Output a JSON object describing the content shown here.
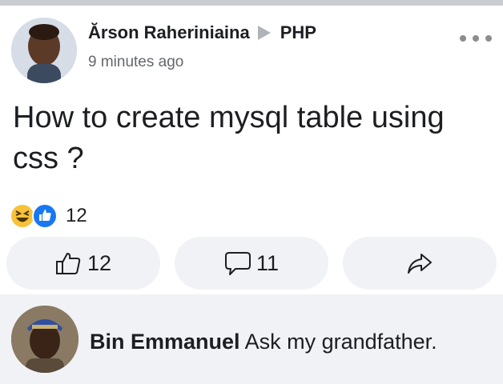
{
  "post": {
    "author": "Ărson Raheriniaina",
    "group": "PHP",
    "time": "9 minutes ago",
    "text": "How to create mysql table using css ?",
    "reaction_count": "12",
    "reaction_icons": [
      "haha-emoji",
      "like-thumb"
    ]
  },
  "actions": {
    "like_count": "12",
    "comment_count": "11",
    "share_icon": "share-arrow-icon"
  },
  "comment": {
    "author": "Bin Emmanuel",
    "text": "Ask my grandfather."
  },
  "colors": {
    "like_blue": "#1877f2",
    "haha_yellow": "#f7c23a",
    "button_bg": "#f0f2f5",
    "text_primary": "#1c1e21",
    "text_secondary": "#65676b"
  }
}
